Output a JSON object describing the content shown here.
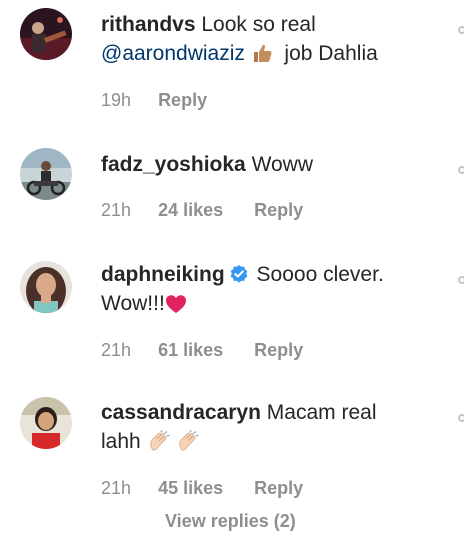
{
  "comments": [
    {
      "username": "rithandvs",
      "text_before": "Look so real",
      "mention": "@aarondwiaziz",
      "text_after": "job Dahlia",
      "time": "19h",
      "likes": "",
      "reply_label": "Reply",
      "emoji_icons": [
        "thumbs-up-icon"
      ]
    },
    {
      "username": "fadz_yoshioka",
      "text": "Woww",
      "time": "21h",
      "likes": "24 likes",
      "reply_label": "Reply"
    },
    {
      "username": "daphneiking",
      "verified": true,
      "text_line1": "Soooo clever.",
      "text_line2": "Wow!!!",
      "time": "21h",
      "likes": "61 likes",
      "reply_label": "Reply",
      "emoji_icons": [
        "red-heart-icon"
      ]
    },
    {
      "username": "cassandracaryn",
      "text_line1": "Macam real",
      "text_line2": "lahh",
      "time": "21h",
      "likes": "45 likes",
      "reply_label": "Reply",
      "emoji_icons": [
        "clapping-hands-icon",
        "clapping-hands-icon"
      ]
    }
  ],
  "view_replies_label": "View replies (2)",
  "colors": {
    "text": "#262626",
    "meta": "#8e8e8e",
    "mention": "#00376b",
    "verified": "#3897f0",
    "heart": "#e0245e"
  }
}
